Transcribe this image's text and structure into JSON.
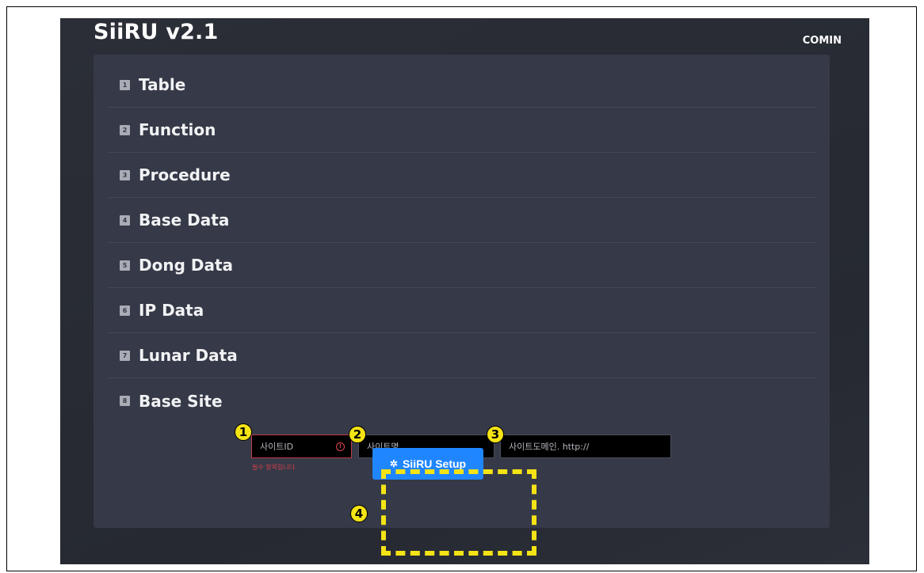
{
  "app": {
    "title": "SiiRU v2.1",
    "user": "COMIN"
  },
  "menu": [
    {
      "num": "1",
      "label": "Table"
    },
    {
      "num": "2",
      "label": "Function"
    },
    {
      "num": "3",
      "label": "Procedure"
    },
    {
      "num": "4",
      "label": "Base Data"
    },
    {
      "num": "5",
      "label": "Dong Data"
    },
    {
      "num": "6",
      "label": "IP Data"
    },
    {
      "num": "7",
      "label": "Lunar Data"
    },
    {
      "num": "8",
      "label": "Base Site"
    }
  ],
  "form": {
    "site_id_placeholder": "사이트ID",
    "site_name_placeholder": "사이트명",
    "site_domain_placeholder": "사이트도메인. http://",
    "required_message": "필수 항목입니다.",
    "setup_button": "SiiRU Setup",
    "gear_icon": "gear-icon",
    "error_icon": "alert-circle-icon"
  },
  "callouts": [
    "1",
    "2",
    "3",
    "4"
  ],
  "colors": {
    "accent": "#1f86ff",
    "highlight": "#f4e315",
    "error": "#d2404a",
    "panel": "#363947",
    "background": "#2b2e37"
  }
}
